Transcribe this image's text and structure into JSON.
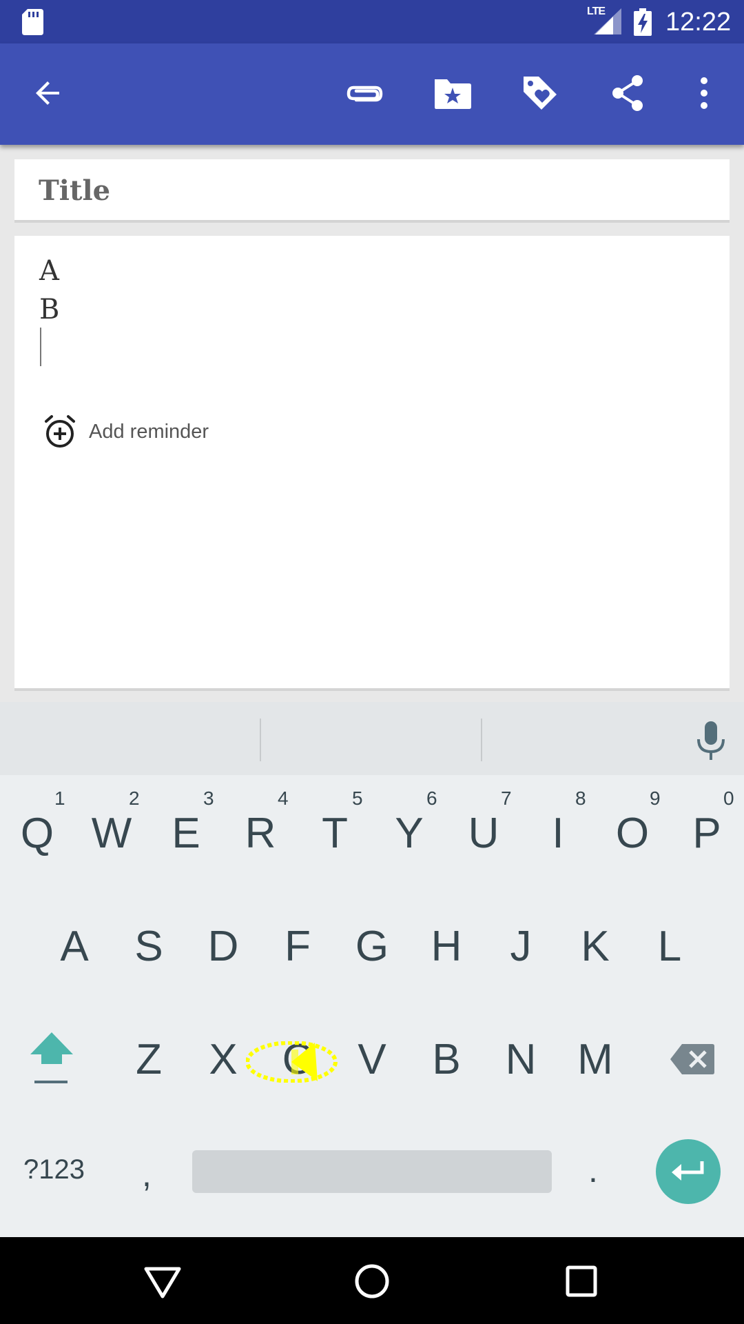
{
  "status_bar": {
    "network": "LTE",
    "time": "12:22"
  },
  "toolbar": {
    "icons": [
      "back-arrow-icon",
      "attachment-icon",
      "category-folder-icon",
      "tag-icon",
      "share-icon",
      "overflow-menu-icon"
    ]
  },
  "note": {
    "title_placeholder": "Title",
    "content_lines": [
      "A",
      "B"
    ],
    "reminder_label": "Add reminder"
  },
  "keyboard": {
    "row1": [
      "Q",
      "W",
      "E",
      "R",
      "T",
      "Y",
      "U",
      "I",
      "O",
      "P"
    ],
    "row1_hints": [
      "1",
      "2",
      "3",
      "4",
      "5",
      "6",
      "7",
      "8",
      "9",
      "0"
    ],
    "row2": [
      "A",
      "S",
      "D",
      "F",
      "G",
      "H",
      "J",
      "K",
      "L"
    ],
    "row3": [
      "Z",
      "X",
      "C",
      "V",
      "B",
      "N",
      "M"
    ],
    "symbols_label": "?123",
    "comma": ",",
    "period": ".",
    "accent_color": "#4db6ac"
  },
  "colors": {
    "status_bar": "#2f3f9e",
    "toolbar": "#3f51b5",
    "tap_indicator": "#ffff00"
  }
}
